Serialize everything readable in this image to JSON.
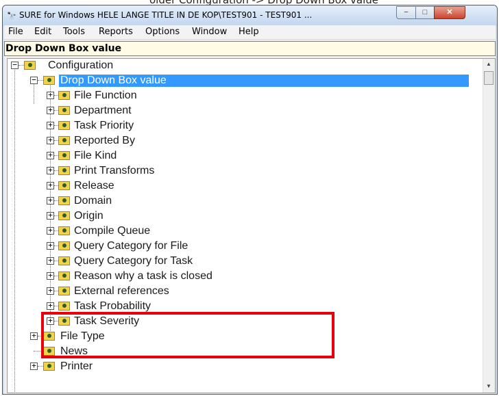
{
  "caption": "older Configuration -> Drop Down Box value",
  "window": {
    "title": "SURE for Windows HELE LANGE TITLE IN DE KOP\\TEST901 - TEST901 ...",
    "controls": {
      "minimize": "−",
      "maximize": "□",
      "close": "✕"
    }
  },
  "menu": [
    "File",
    "Edit",
    "Tools",
    "Reports",
    "Options",
    "Window",
    "Help"
  ],
  "panel_header": "Drop Down Box value",
  "tree": {
    "root": "Configuration",
    "selected": "Drop Down Box value",
    "children": [
      "File Function",
      "Department",
      "Task Priority",
      "Reported By",
      "File Kind",
      "Print Transforms",
      "Release",
      "Domain",
      "Origin",
      "Compile Queue",
      "Query Category for File",
      "Query Category for Task",
      "Reason why a task is closed",
      "External references",
      "Task Probability",
      "Task Severity"
    ],
    "siblings": [
      "File Type",
      "News",
      "Printer"
    ]
  },
  "expander": {
    "collapsed": "+",
    "expanded": "−"
  },
  "annotation": {
    "color": "#e8000b",
    "highlighted": [
      "Task Probability",
      "Task Severity"
    ]
  },
  "colors": {
    "selection": "#3399ff",
    "header_bg": "#fffbe4",
    "folder": "#f2d24c"
  }
}
